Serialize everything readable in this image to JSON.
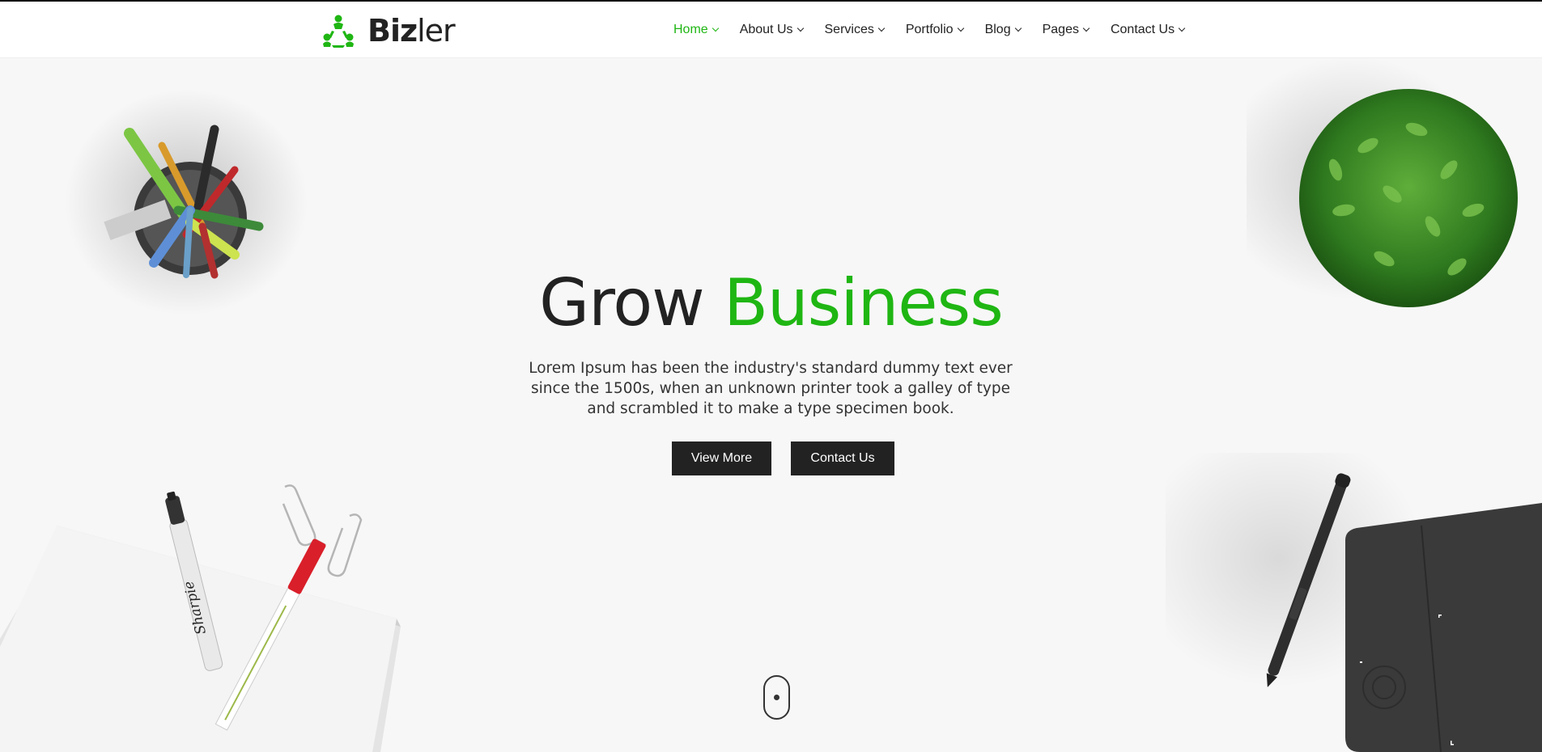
{
  "brand": {
    "name_bold": "Biz",
    "name_light": "ler",
    "logo_icon": "tri-people-logo-icon",
    "accent": "#1fb613"
  },
  "nav": {
    "items": [
      {
        "label": "Home",
        "active": true
      },
      {
        "label": "About Us",
        "active": false
      },
      {
        "label": "Services",
        "active": false
      },
      {
        "label": "Portfolio",
        "active": false
      },
      {
        "label": "Blog",
        "active": false
      },
      {
        "label": "Pages",
        "active": false
      },
      {
        "label": "Contact Us",
        "active": false
      }
    ],
    "dropdown_icon": "chevron-down-icon"
  },
  "hero": {
    "title_part1": "Grow",
    "title_part2": "Business",
    "description": "Lorem Ipsum has been the industry's standard dummy text ever since the 1500s, when an unknown printer took a galley of type and scrambled it to make a type specimen book.",
    "buttons": {
      "view_more": "View More",
      "contact_us": "Contact Us"
    }
  },
  "decor": {
    "sharpie_text": "Sharpie",
    "scroll_icon": "mouse-scroll-icon"
  },
  "colors": {
    "accent": "#1fb613",
    "dark": "#222222",
    "background": "#f7f7f7"
  }
}
